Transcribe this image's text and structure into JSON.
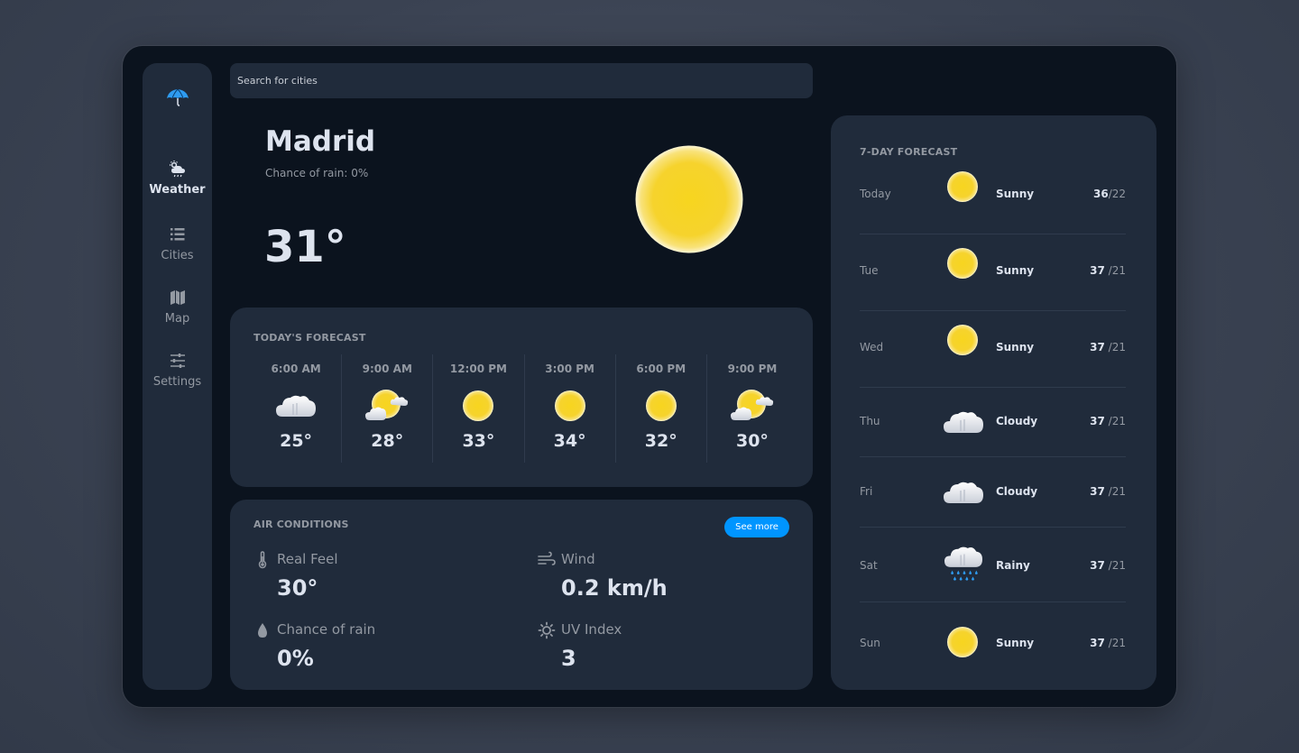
{
  "sidebar": {
    "logo_icon": "umbrella-icon",
    "items": [
      {
        "label": "Weather",
        "icon": "weather-icon",
        "active": true
      },
      {
        "label": "Cities",
        "icon": "list-icon",
        "active": false
      },
      {
        "label": "Map",
        "icon": "map-icon",
        "active": false
      },
      {
        "label": "Settings",
        "icon": "sliders-icon",
        "active": false
      }
    ]
  },
  "search": {
    "placeholder": "Search for cities",
    "value": ""
  },
  "current": {
    "city": "Madrid",
    "rain": "Chance of rain: 0%",
    "temp": "31°",
    "icon": "sun-icon"
  },
  "today": {
    "title": "TODAY'S FORECAST",
    "hours": [
      {
        "time": "6:00 AM",
        "icon": "cloud-icon",
        "temp": "25°"
      },
      {
        "time": "9:00 AM",
        "icon": "partly-cloudy-icon",
        "temp": "28°"
      },
      {
        "time": "12:00 PM",
        "icon": "sun-icon",
        "temp": "33°"
      },
      {
        "time": "3:00 PM",
        "icon": "sun-icon",
        "temp": "34°"
      },
      {
        "time": "6:00 PM",
        "icon": "sun-icon",
        "temp": "32°"
      },
      {
        "time": "9:00 PM",
        "icon": "partly-cloudy-icon",
        "temp": "30°"
      }
    ]
  },
  "air": {
    "title": "AIR CONDITIONS",
    "see_more": "See more",
    "real_feel": {
      "label": "Real Feel",
      "value": "30°"
    },
    "wind": {
      "label": "Wind",
      "value": "0.2 km/h"
    },
    "rain": {
      "label": "Chance of rain",
      "value": "0%"
    },
    "uv": {
      "label": "UV Index",
      "value": "3"
    }
  },
  "week": {
    "title": "7-DAY FORECAST",
    "days": [
      {
        "day": "Today",
        "icon": "sun-icon",
        "cond": "Sunny",
        "high": "36",
        "low": "/22"
      },
      {
        "day": "Tue",
        "icon": "sun-icon",
        "cond": "Sunny",
        "high": "37",
        "low": " /21"
      },
      {
        "day": "Wed",
        "icon": "sun-icon",
        "cond": "Sunny",
        "high": "37",
        "low": " /21"
      },
      {
        "day": "Thu",
        "icon": "cloud-icon",
        "cond": "Cloudy",
        "high": "37",
        "low": " /21"
      },
      {
        "day": "Fri",
        "icon": "cloud-icon",
        "cond": "Cloudy",
        "high": "37",
        "low": " /21"
      },
      {
        "day": "Sat",
        "icon": "rain-cloud-icon",
        "cond": "Rainy",
        "high": "37",
        "low": " /21"
      },
      {
        "day": "Sun",
        "icon": "sun-icon",
        "cond": "Sunny",
        "high": "37",
        "low": " /21"
      }
    ]
  },
  "colors": {
    "background": "#3a4252",
    "panel": "#0b131e",
    "card": "#202b3b",
    "text": "#dde3ee",
    "muted": "#9399a2",
    "accent": "#0095ff",
    "sun": "#f6d32d"
  }
}
